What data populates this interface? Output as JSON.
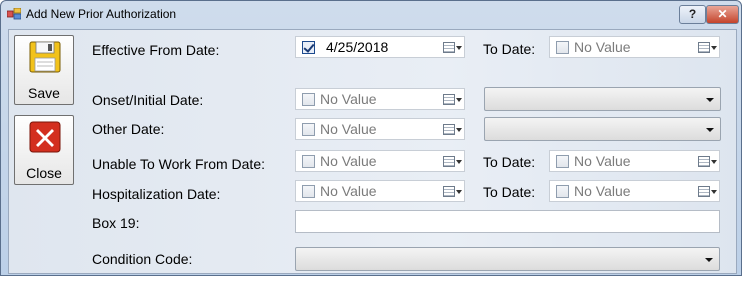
{
  "window": {
    "title": "Add New Prior Authorization",
    "help_glyph": "?",
    "close_glyph": "✕"
  },
  "sidebar": {
    "save_label": "Save",
    "close_label": "Close"
  },
  "form": {
    "effective_from_label": "Effective From Date:",
    "effective_from_checked": true,
    "effective_from_value": "4/25/2018",
    "to_date_label": "To Date:",
    "no_value": "No Value",
    "onset_label": "Onset/Initial Date:",
    "other_label": "Other Date:",
    "unable_label": "Unable To Work From Date:",
    "hosp_label": "Hospitalization Date:",
    "box19_label": "Box 19:",
    "box19_value": "",
    "condition_label": "Condition Code:"
  }
}
